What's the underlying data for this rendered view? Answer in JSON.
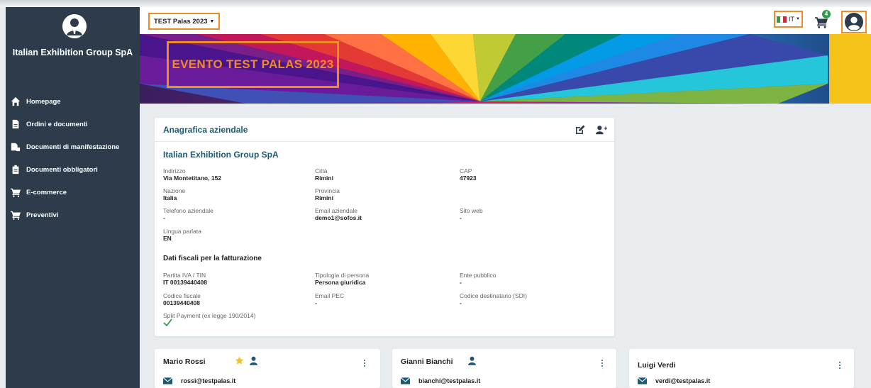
{
  "sidebar": {
    "org_name": "Italian Exhibition Group SpA",
    "items": [
      {
        "label": "Homepage",
        "icon": "home-icon"
      },
      {
        "label": "Ordini e documenti",
        "icon": "file-icon"
      },
      {
        "label": "Documenti di manifestazione",
        "icon": "documents-lock-icon"
      },
      {
        "label": "Documenti obbligatori",
        "icon": "clipboard-icon"
      },
      {
        "label": "E-commerce",
        "icon": "cart-icon"
      },
      {
        "label": "Preventivi",
        "icon": "cart-icon"
      }
    ]
  },
  "topbar": {
    "event_selector": "TEST Palas 2023",
    "language": "IT",
    "cart_count": "4"
  },
  "banner": {
    "title": "EVENTO TEST PALAS 2023"
  },
  "company": {
    "card_title": "Anagrafica aziendale",
    "name": "Italian Exhibition Group SpA",
    "fields": {
      "indirizzo": {
        "label": "Indirizzo",
        "value": "Via Montetitano, 152"
      },
      "citta": {
        "label": "Città",
        "value": "Rimini"
      },
      "cap": {
        "label": "CAP",
        "value": "47923"
      },
      "nazione": {
        "label": "Nazione",
        "value": "Italia"
      },
      "provincia": {
        "label": "Provincia",
        "value": "Rimini"
      },
      "telefono": {
        "label": "Telefono aziendale",
        "value": "-"
      },
      "email": {
        "label": "Email aziendale",
        "value": "demo1@sofos.it"
      },
      "sito": {
        "label": "Sito web",
        "value": "-"
      },
      "lingua": {
        "label": "Lingua parlata",
        "value": "EN"
      }
    },
    "billing_title": "Dati fiscali per la fatturazione",
    "billing": {
      "piva": {
        "label": "Partita IVA / TIN",
        "value": "IT 00139440408"
      },
      "tipologia": {
        "label": "Tipologia di persona",
        "value": "Persona giuridica"
      },
      "ente": {
        "label": "Ente pubblico",
        "value": "-"
      },
      "cf": {
        "label": "Codice fiscale",
        "value": "00139440408"
      },
      "pec": {
        "label": "Email PEC",
        "value": "-"
      },
      "sdi": {
        "label": "Codice destinatario (SDI)",
        "value": "-"
      },
      "split": {
        "label": "Split Payment (ex legge 190/2014)"
      }
    }
  },
  "contacts": [
    {
      "name": "Mario Rossi",
      "email": "rossi@testpalas.it"
    },
    {
      "name": "Gianni Bianchi",
      "email": "bianchi@testpalas.it"
    },
    {
      "name": "Luigi Verdi",
      "email": "verdi@testpalas.it"
    }
  ],
  "colors": {
    "sidebar": "#2d3b4a",
    "accent_orange": "#f08a24",
    "title_teal": "#1c5a73",
    "success_green": "#2e9c4b",
    "star_yellow": "#f5c32c"
  }
}
